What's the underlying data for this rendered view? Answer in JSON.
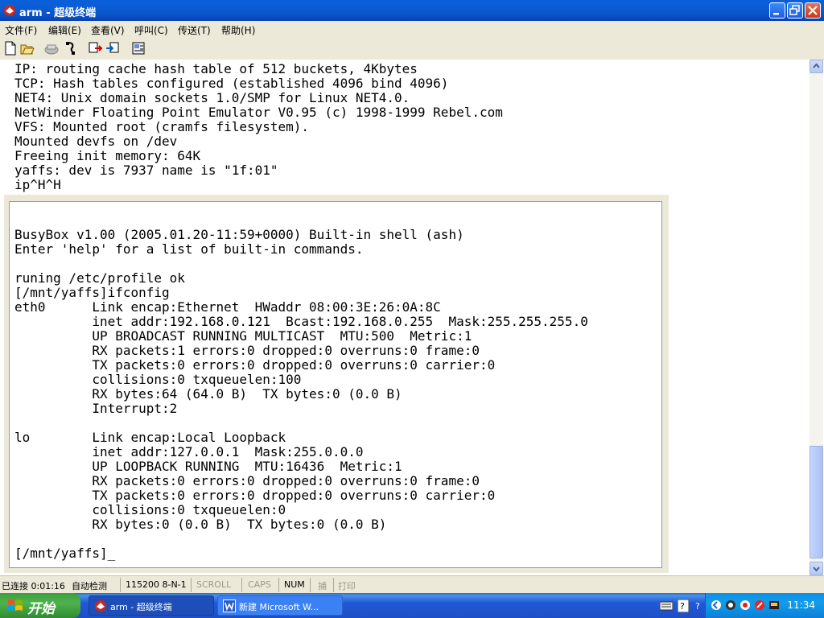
{
  "window": {
    "title": "arm - 超级终端",
    "controls": [
      "minimize-icon",
      "restore-icon",
      "close-icon"
    ]
  },
  "menu": {
    "items": [
      "文件(F)",
      "编辑(E)",
      "查看(V)",
      "呼叫(C)",
      "传送(T)",
      "帮助(H)"
    ]
  },
  "toolbar": {
    "icons": [
      "new-icon",
      "open-icon",
      "disconnect-icon",
      "hangup-icon",
      "send-icon",
      "receive-icon",
      "properties-icon"
    ]
  },
  "terminal": {
    "outer_text": "IP: routing cache hash table of 512 buckets, 4Kbytes\nTCP: Hash tables configured (established 4096 bind 4096)\nNET4: Unix domain sockets 1.0/SMP for Linux NET4.0.\nNetWinder Floating Point Emulator V0.95 (c) 1998-1999 Rebel.com\nVFS: Mounted root (cramfs filesystem).\nMounted devfs on /dev\nFreeing init memory: 64K\nyaffs: dev is 7937 name is \"1f:01\"\nip^H^H",
    "inner_text": "BusyBox v1.00 (2005.01.20-11:59+0000) Built-in shell (ash)\nEnter 'help' for a list of built-in commands.\n\nruning /etc/profile ok\n[/mnt/yaffs]ifconfig\neth0      Link encap:Ethernet  HWaddr 08:00:3E:26:0A:8C\n          inet addr:192.168.0.121  Bcast:192.168.0.255  Mask:255.255.255.0\n          UP BROADCAST RUNNING MULTICAST  MTU:500  Metric:1\n          RX packets:1 errors:0 dropped:0 overruns:0 frame:0\n          TX packets:0 errors:0 dropped:0 overruns:0 carrier:0\n          collisions:0 txqueuelen:100\n          RX bytes:64 (64.0 B)  TX bytes:0 (0.0 B)\n          Interrupt:2\n\nlo        Link encap:Local Loopback\n          inet addr:127.0.0.1  Mask:255.0.0.0\n          UP LOOPBACK RUNNING  MTU:16436  Metric:1\n          RX packets:0 errors:0 dropped:0 overruns:0 frame:0\n          TX packets:0 errors:0 dropped:0 overruns:0 carrier:0\n          collisions:0 txqueuelen:0\n          RX bytes:0 (0.0 B)  TX bytes:0 (0.0 B)\n\n[/mnt/yaffs]_"
  },
  "status": {
    "connection": "已连接 0:01:16",
    "detect": "自动检测",
    "port": "115200 8-N-1",
    "scroll": "SCROLL",
    "caps": "CAPS",
    "num": "NUM",
    "capture": "捕",
    "print": "打印"
  },
  "taskbar": {
    "start": "开始",
    "tasks": [
      {
        "label": "arm - 超级终端",
        "icon": "hyperterminal-icon",
        "active": true
      },
      {
        "label": "新建 Microsoft W...",
        "icon": "word-icon",
        "active": false
      }
    ],
    "tray_icons": [
      "keyboard-icon",
      "help-icon",
      "info-icon",
      "back-icon",
      "app-icon",
      "app-icon",
      "app-icon",
      "app-icon"
    ],
    "clock": "11:34"
  },
  "colors": {
    "titlebar": "#0a5fd8",
    "chrome": "#ece9d8",
    "start_green": "#3c9e3d",
    "taskbar_blue": "#2157d7",
    "tray_blue": "#0c91e8"
  }
}
